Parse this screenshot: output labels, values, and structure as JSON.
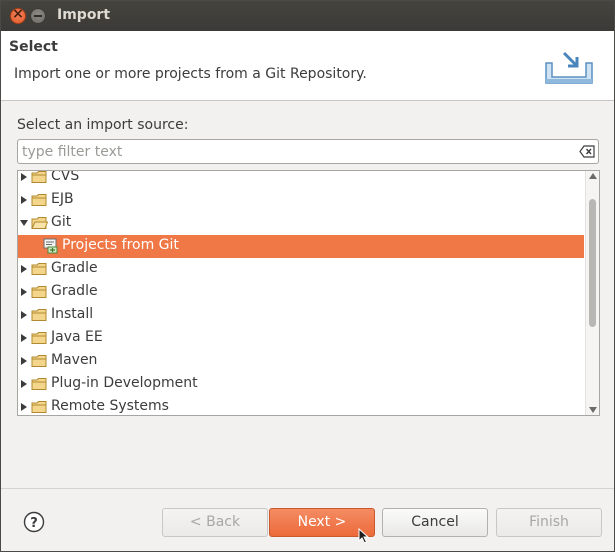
{
  "window": {
    "title": "Import"
  },
  "header": {
    "title": "Select",
    "description": "Import one or more projects from a Git Repository."
  },
  "source": {
    "label": "Select an import source:",
    "filter_placeholder": "type filter text",
    "filter_value": ""
  },
  "tree": {
    "items": [
      {
        "label": "CVS",
        "expanded": false
      },
      {
        "label": "EJB",
        "expanded": false
      },
      {
        "label": "Git",
        "expanded": true
      },
      {
        "label": "Projects from Git",
        "child": true,
        "selected": true
      },
      {
        "label": "Gradle",
        "expanded": false
      },
      {
        "label": "Gradle",
        "expanded": false
      },
      {
        "label": "Install",
        "expanded": false
      },
      {
        "label": "Java EE",
        "expanded": false
      },
      {
        "label": "Maven",
        "expanded": false
      },
      {
        "label": "Plug-in Development",
        "expanded": false
      },
      {
        "label": "Remote Systems",
        "expanded": false
      }
    ]
  },
  "buttons": {
    "back": "< Back",
    "next": "Next >",
    "cancel": "Cancel",
    "finish": "Finish"
  },
  "colors": {
    "selection": "#f07746",
    "titlebar": "#3c3b37",
    "accent": "#ec6a3a"
  }
}
